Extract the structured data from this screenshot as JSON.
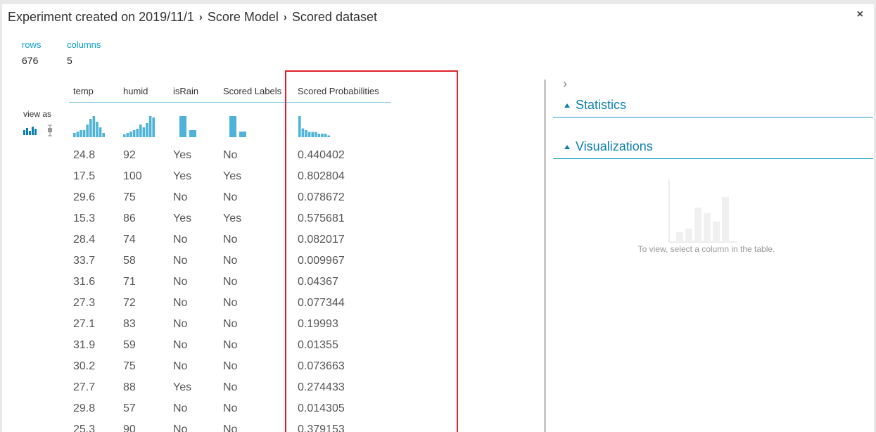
{
  "breadcrumb": {
    "items": [
      "Experiment created on 2019/11/1",
      "Score Model",
      "Scored dataset"
    ],
    "separator": "›"
  },
  "close_label": "×",
  "stats": {
    "rows_label": "rows",
    "rows_value": "676",
    "columns_label": "columns",
    "columns_value": "5"
  },
  "view_as_label": "view as",
  "columns": [
    "temp",
    "humid",
    "isRain",
    "Scored Labels",
    "Scored Probabilities"
  ],
  "rows": [
    [
      "24.8",
      "92",
      "Yes",
      "No",
      "0.440402"
    ],
    [
      "17.5",
      "100",
      "Yes",
      "Yes",
      "0.802804"
    ],
    [
      "29.6",
      "75",
      "No",
      "No",
      "0.078672"
    ],
    [
      "15.3",
      "86",
      "Yes",
      "Yes",
      "0.575681"
    ],
    [
      "28.4",
      "74",
      "No",
      "No",
      "0.082017"
    ],
    [
      "33.7",
      "58",
      "No",
      "No",
      "0.009967"
    ],
    [
      "31.6",
      "71",
      "No",
      "No",
      "0.04367"
    ],
    [
      "27.3",
      "72",
      "No",
      "No",
      "0.077344"
    ],
    [
      "27.1",
      "83",
      "No",
      "No",
      "0.19993"
    ],
    [
      "31.9",
      "59",
      "No",
      "No",
      "0.01355"
    ],
    [
      "30.2",
      "75",
      "No",
      "No",
      "0.073663"
    ],
    [
      "27.7",
      "88",
      "Yes",
      "No",
      "0.274433"
    ],
    [
      "29.8",
      "57",
      "No",
      "No",
      "0.014305"
    ],
    [
      "25.3",
      "90",
      "No",
      "No",
      "0.379153"
    ]
  ],
  "histograms": [
    [
      3,
      4,
      5,
      5,
      9,
      13,
      15,
      11,
      7,
      3
    ],
    [
      2,
      3,
      4,
      5,
      6,
      9,
      7,
      10,
      15,
      14
    ],
    [
      15,
      5
    ],
    [
      15,
      4
    ],
    [
      12,
      5,
      4,
      3,
      3,
      3,
      2,
      2,
      2,
      1
    ]
  ],
  "right_panel": {
    "expand_icon": "chevron-right-icon",
    "statistics_label": "Statistics",
    "visualizations_label": "Visualizations",
    "placeholder_text": "To view, select a column in the table."
  },
  "colors": {
    "accent": "#0d9fcf",
    "highlight": "#e0222a",
    "histogram": "#4fb3d9"
  }
}
